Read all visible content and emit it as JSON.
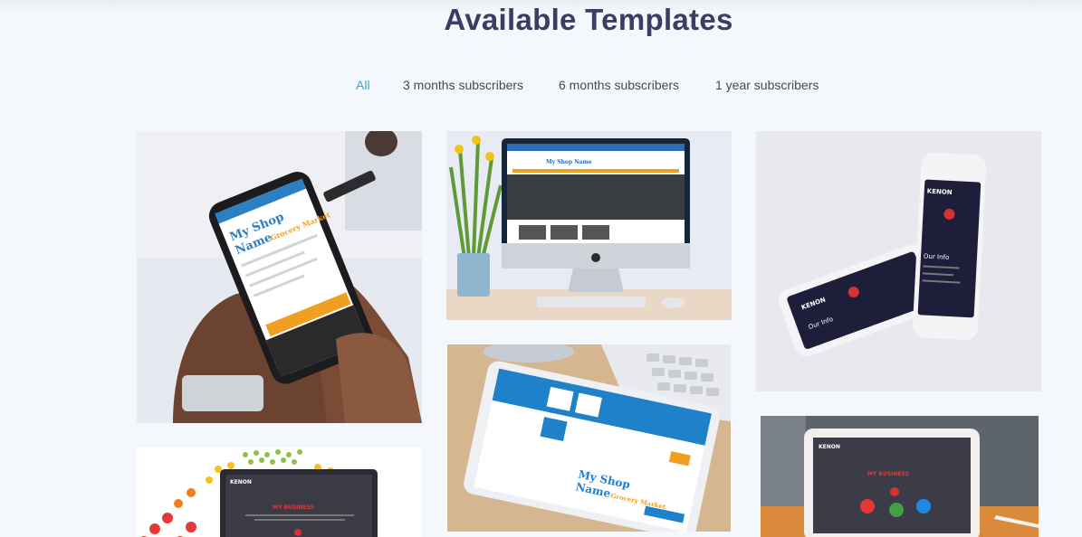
{
  "page": {
    "title": "Available Templates"
  },
  "filters": [
    {
      "label": "All",
      "active": true
    },
    {
      "label": "3 months subscribers",
      "active": false
    },
    {
      "label": "6 months subscribers",
      "active": false
    },
    {
      "label": "1 year subscribers",
      "active": false
    }
  ],
  "templates": [
    {
      "mockup": "phone-in-hand",
      "screen_title": "My Shop Name",
      "screen_subtitle": "Grocery Market"
    },
    {
      "mockup": "desktop-monitor",
      "screen_title": "My Shop Name"
    },
    {
      "mockup": "two-phones",
      "screen_title": "KENON",
      "screen_section": "Our Info"
    },
    {
      "mockup": "laptop-dots",
      "screen_title": "KENON",
      "screen_heading": "MY BUSINESS"
    },
    {
      "mockup": "tablet-on-desk",
      "screen_title": "My Shop Name",
      "screen_subtitle": "Grocery Market"
    },
    {
      "mockup": "tablet-landscape",
      "screen_title": "KENON",
      "screen_heading": "MY BUSINESS"
    }
  ],
  "colors": {
    "title": "#3c3d63",
    "filter_active": "#3aa7c7",
    "filter_text": "#444b57",
    "background": "#f4f7fb"
  }
}
